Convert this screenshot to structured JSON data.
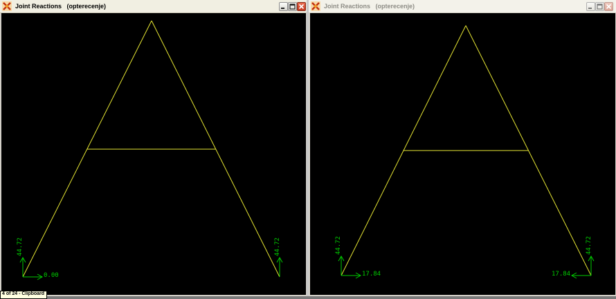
{
  "windows": [
    {
      "title": "Joint Reactions   (opterecenje)",
      "state": "active",
      "reactions": {
        "left_vertical": "44.72",
        "left_horizontal": "0.00",
        "right_vertical": "44.72"
      }
    },
    {
      "title": "Joint Reactions   (opterecenje)",
      "state": "inactive",
      "reactions": {
        "left_vertical": "44.72",
        "left_horizontal": "17.84",
        "right_vertical": "44.72",
        "right_horizontal": "17.84"
      }
    }
  ],
  "taskbar_tooltip": "4 of 24 - Clipboard",
  "colors": {
    "structure": "#e6e633",
    "reaction": "#00cc00",
    "viewport_background": "#000000"
  },
  "icons": [
    "app-icon",
    "minimize-icon",
    "maximize-icon",
    "close-icon"
  ]
}
